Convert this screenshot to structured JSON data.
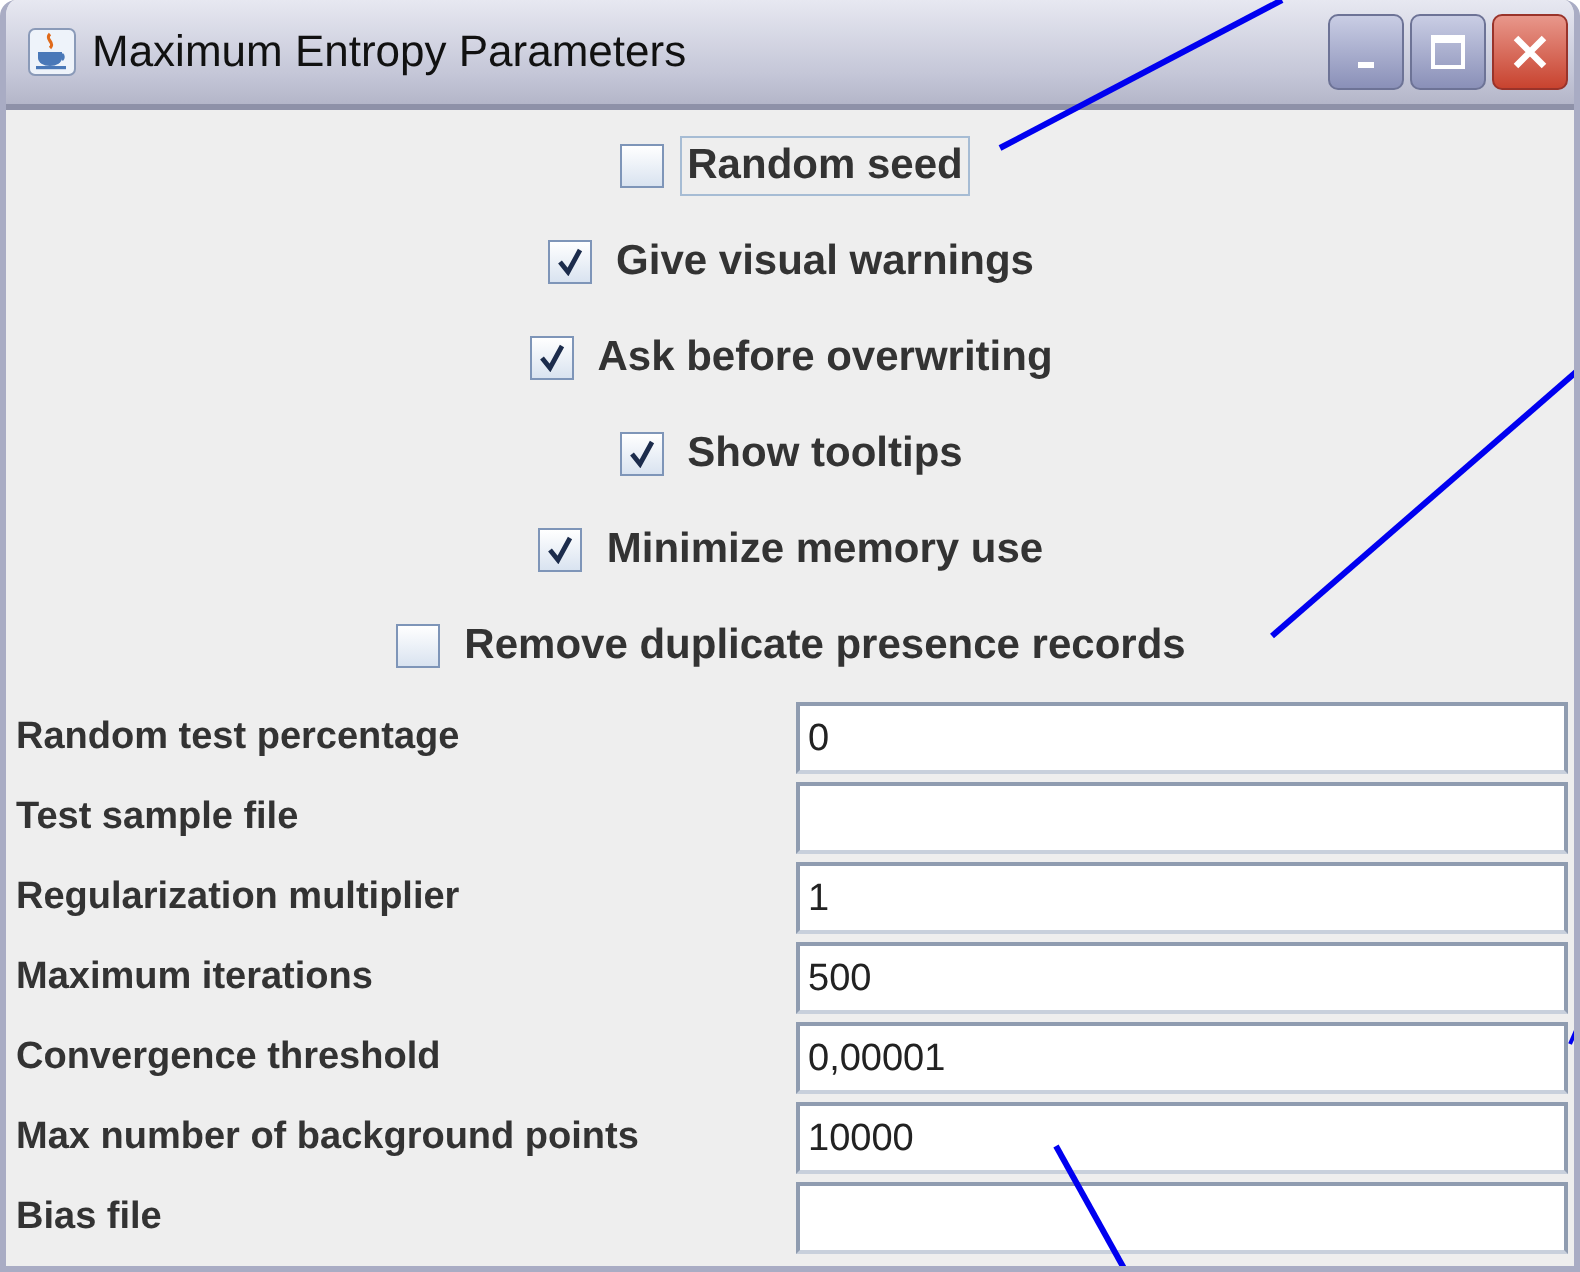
{
  "window": {
    "title": "Maximum Entropy Parameters"
  },
  "options": [
    {
      "label": "Random seed",
      "checked": false,
      "focused": true
    },
    {
      "label": "Give visual warnings",
      "checked": true,
      "focused": false
    },
    {
      "label": "Ask before overwriting",
      "checked": true,
      "focused": false
    },
    {
      "label": "Show tooltips",
      "checked": true,
      "focused": false
    },
    {
      "label": "Minimize memory use",
      "checked": true,
      "focused": false
    },
    {
      "label": "Remove duplicate presence records",
      "checked": false,
      "focused": false
    }
  ],
  "fields": [
    {
      "label": "Random test percentage",
      "value": "0"
    },
    {
      "label": "Test sample file"
    },
    {
      "label": "Regularization multiplier",
      "value": "1"
    },
    {
      "label": "Maximum iterations",
      "value": "500"
    },
    {
      "label": "Convergence threshold",
      "value": "0,00001"
    },
    {
      "label": "Max number of background points",
      "value": "10000"
    },
    {
      "label": "Bias file"
    }
  ]
}
